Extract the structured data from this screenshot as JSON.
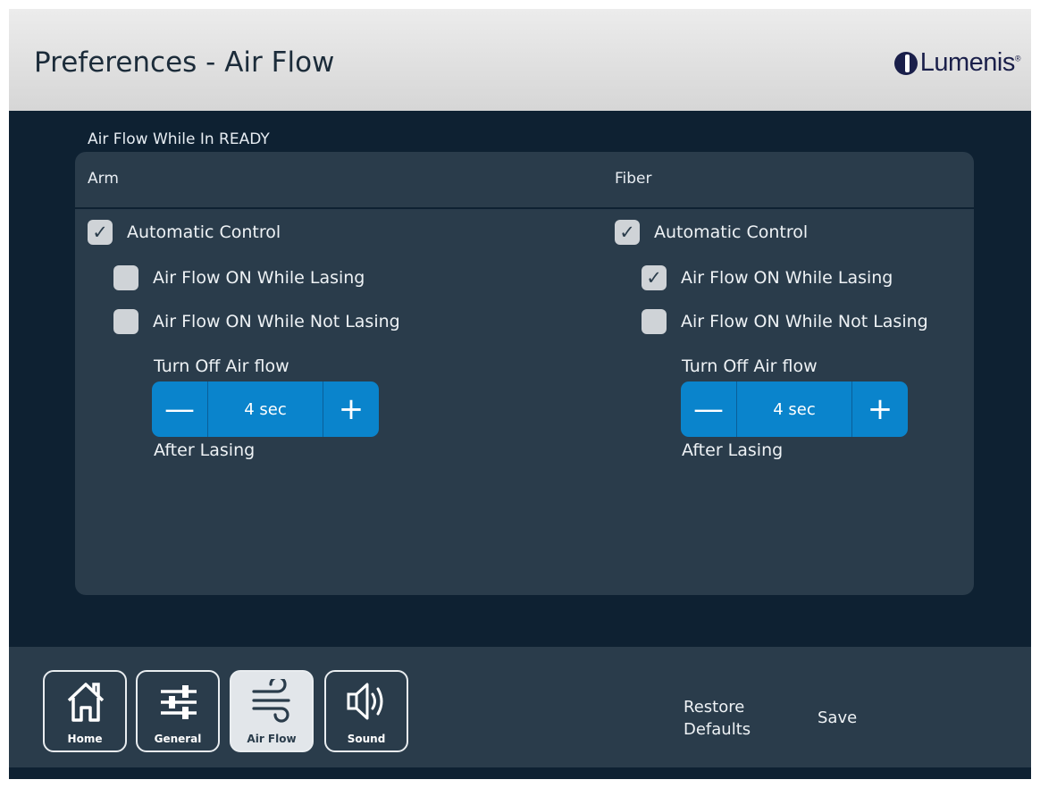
{
  "header": {
    "title": "Preferences - Air Flow",
    "logo_text": "Lumenis",
    "logo_sup": "®"
  },
  "section_label": "Air Flow While In READY",
  "arm": {
    "heading": "Arm",
    "automatic_control": {
      "label": "Automatic Control",
      "checked": true,
      "mark": "✓"
    },
    "on_while_lasing": {
      "label": "Air Flow ON While Lasing",
      "checked": false,
      "mark": ""
    },
    "on_while_not_lasing": {
      "label": "Air Flow ON While Not Lasing",
      "checked": false,
      "mark": ""
    },
    "turn_off_label": "Turn Off Air flow",
    "stepper": {
      "minus": "—",
      "value": "4 sec",
      "plus": "+"
    },
    "after_label": "After Lasing"
  },
  "fiber": {
    "heading": "Fiber",
    "automatic_control": {
      "label": "Automatic Control",
      "checked": true,
      "mark": "✓"
    },
    "on_while_lasing": {
      "label": "Air Flow ON While Lasing",
      "checked": true,
      "mark": "✓"
    },
    "on_while_not_lasing": {
      "label": "Air Flow ON While Not Lasing",
      "checked": false,
      "mark": ""
    },
    "turn_off_label": "Turn Off Air flow",
    "stepper": {
      "minus": "—",
      "value": "4 sec",
      "plus": "+"
    },
    "after_label": "After Lasing"
  },
  "footer": {
    "nav": [
      {
        "label": "Home",
        "icon": "home-icon",
        "active": false
      },
      {
        "label": "General",
        "icon": "sliders-icon",
        "active": false
      },
      {
        "label": "Air Flow",
        "icon": "wind-icon",
        "active": true
      },
      {
        "label": "Sound",
        "icon": "speaker-icon",
        "active": false
      }
    ],
    "restore_defaults_line1": "Restore",
    "restore_defaults_line2": "Defaults",
    "save": "Save"
  },
  "colors": {
    "background": "#0e2132",
    "panel": "#2a3c4b",
    "accent": "#0a84cc",
    "checkbox": "#cfd3d7"
  }
}
